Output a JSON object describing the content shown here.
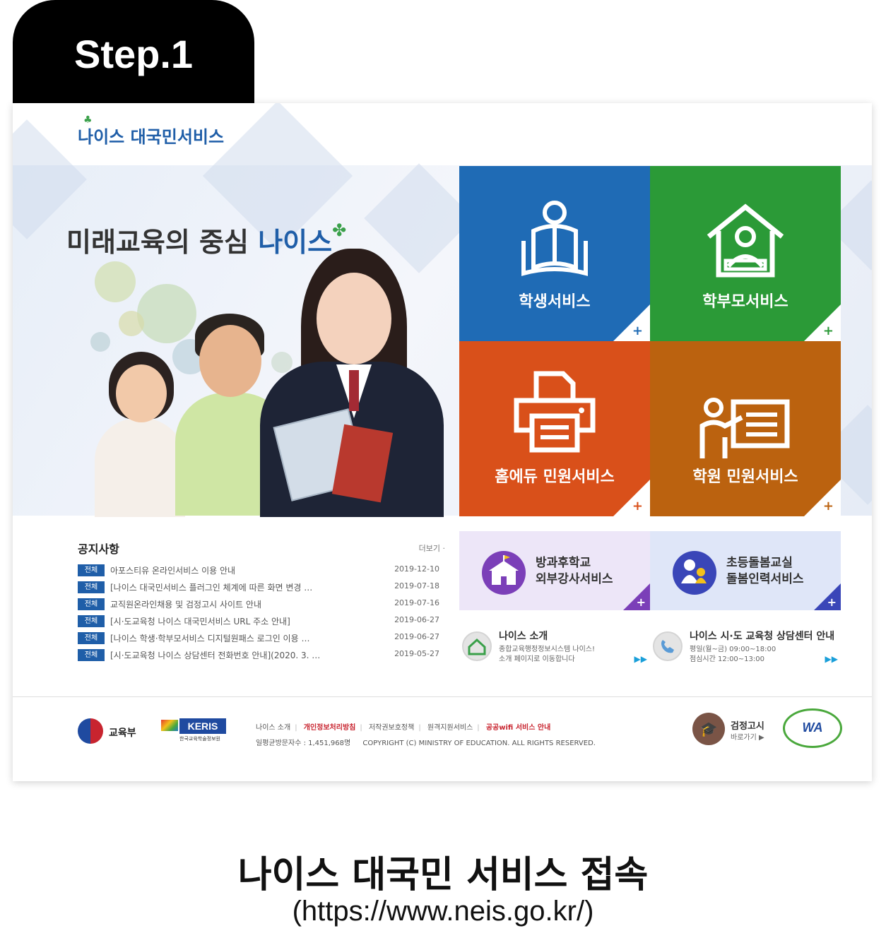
{
  "step": {
    "label": "Step.1"
  },
  "header": {
    "logo_text": "나이스 대국민서비스"
  },
  "hero": {
    "title_main": "미래교육의 중심 ",
    "title_accent": "나이스"
  },
  "tiles": [
    {
      "label": "학생서비스",
      "color": "#1f6bb5",
      "icon": "student-reading-icon"
    },
    {
      "label": "학부모서비스",
      "color": "#2b9a37",
      "icon": "house-parent-icon"
    },
    {
      "label": "홈에듀 민원서비스",
      "color": "#d9501a",
      "icon": "printer-icon"
    },
    {
      "label": "학원 민원서비스",
      "color": "#bb620f",
      "icon": "teacher-board-icon"
    }
  ],
  "tile_plus": "+",
  "notice": {
    "title": "공지사항",
    "more": "더보기",
    "badge": "전체",
    "items": [
      {
        "text": "아포스티유 온라인서비스 이용 안내",
        "date": "2019-12-10"
      },
      {
        "text": "[나이스 대국민서비스 플러그인 체계에 따른 화면 변경 …",
        "date": "2019-07-18"
      },
      {
        "text": "교직원온라인채용 및 검정고시 사이트 안내",
        "date": "2019-07-16"
      },
      {
        "text": "[시·도교육청 나이스 대국민서비스 URL 주소 안내]",
        "date": "2019-06-27"
      },
      {
        "text": "[나이스 학생·학부모서비스 디지털원패스 로그인 이용 …",
        "date": "2019-06-27"
      },
      {
        "text": "[시·도교육청 나이스 상담센터 전화번호 안내](2020. 3. …",
        "date": "2019-05-27"
      }
    ]
  },
  "services": [
    {
      "line1": "방과후학교",
      "line2": "외부강사서비스",
      "bg": "#ede6f8",
      "accent": "#7b3fb8"
    },
    {
      "line1": "초등돌봄교실",
      "line2": "돌봄인력서비스",
      "bg": "#dfe6f8",
      "accent": "#3a46b8"
    }
  ],
  "info": [
    {
      "title": "나이스 소개",
      "line1": "종합교육행정정보시스템 나이스!",
      "line2": "소개 페이지로 이동합니다",
      "arrows": "▶▶"
    },
    {
      "title": "나이스 시·도 교육청 상담센터 안내",
      "line1": "평일(월~금) 09:00~18:00",
      "line2": "점심시간 12:00~13:00",
      "arrows": "▶▶"
    }
  ],
  "footer": {
    "moe": "교육부",
    "keris": "KERIS",
    "keris_sub": "한국교육학술정보원",
    "links": [
      "나이스 소개",
      "개인정보처리방침",
      "저작권보호정책",
      "원격지원서비스",
      "공공wifi 서비스 안내"
    ],
    "visitors": "일평균방문자수 : 1,451,968명",
    "copyright": "COPYRIGHT (C) MINISTRY OF EDUCATION. ALL RIGHTS RESERVED.",
    "ged_title": "검정고시",
    "ged_sub": "바로가기 ▶",
    "wa": "WA"
  },
  "caption": {
    "title": "나이스 대국민 서비스 접속",
    "url": "(https://www.neis.go.kr/)"
  }
}
